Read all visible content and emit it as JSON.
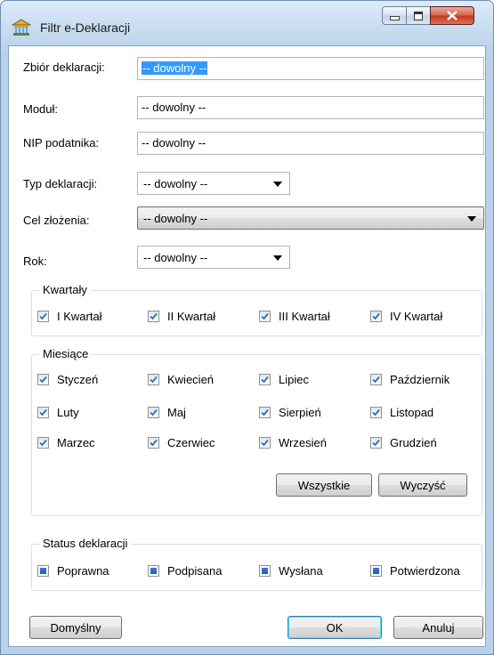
{
  "window": {
    "title": "Filtr e-Deklaracji",
    "icon": "bank-building-icon"
  },
  "fields": {
    "zbior": {
      "label": "Zbiór deklaracji:",
      "value": "-- dowolny --"
    },
    "modul": {
      "label": "Moduł:",
      "value": "-- dowolny --"
    },
    "nip": {
      "label": "NIP podatnika:",
      "value": "-- dowolny --"
    },
    "typ": {
      "label": "Typ deklaracji:",
      "value": "-- dowolny --"
    },
    "cel": {
      "label": "Cel złożenia:",
      "value": "-- dowolny --"
    },
    "rok": {
      "label": "Rok:",
      "value": "-- dowolny --"
    }
  },
  "kwartaly": {
    "title": "Kwartały",
    "items": [
      "I Kwartał",
      "II Kwartał",
      "III Kwartał",
      "IV Kwartał"
    ]
  },
  "miesiace": {
    "title": "Miesiące",
    "items": [
      "Styczeń",
      "Kwiecień",
      "Lipiec",
      "Październik",
      "Luty",
      "Maj",
      "Sierpień",
      "Listopad",
      "Marzec",
      "Czerwiec",
      "Wrzesień",
      "Grudzień"
    ],
    "buttons": {
      "all": "Wszystkie",
      "clear": "Wyczyść"
    }
  },
  "status": {
    "title": "Status deklaracji",
    "items": [
      "Poprawna",
      "Podpisana",
      "Wysłana",
      "Potwierdzona"
    ]
  },
  "footer": {
    "default": "Domyślny",
    "ok": "OK",
    "cancel": "Anuluj"
  },
  "colors": {
    "selection": "#3399ff",
    "accent": "#2f6db8"
  }
}
